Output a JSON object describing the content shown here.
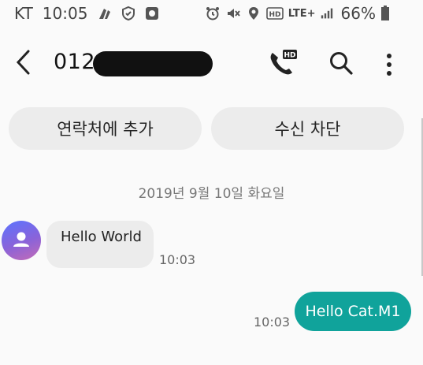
{
  "status_bar": {
    "carrier": "KT",
    "time": "10:05",
    "network": "LTE+",
    "battery_percent": "66%",
    "icons": [
      "hands-icon",
      "shield-icon",
      "app-icon",
      "alarm-icon",
      "mute-icon",
      "location-icon",
      "hd-icon",
      "signal-icon",
      "battery-icon"
    ]
  },
  "header": {
    "contact_number_visible": "012-",
    "back_icon": "back-arrow-icon",
    "actions": [
      "hd-call-icon",
      "search-icon",
      "more-options-icon"
    ]
  },
  "actions": {
    "add_contact": "연락처에 추가",
    "block_number": "수신 차단"
  },
  "conversation": {
    "date_label": "2019년 9월 10일 화요일",
    "messages": [
      {
        "direction": "incoming",
        "text": "Hello World",
        "time": "10:03"
      },
      {
        "direction": "outgoing",
        "text": "Hello Cat.M1",
        "time": "10:03"
      }
    ]
  },
  "colors": {
    "outgoing_bubble": "#10a39b",
    "incoming_bubble": "#ececec",
    "avatar_gradient": [
      "#5b74ff",
      "#c46bb6"
    ]
  }
}
